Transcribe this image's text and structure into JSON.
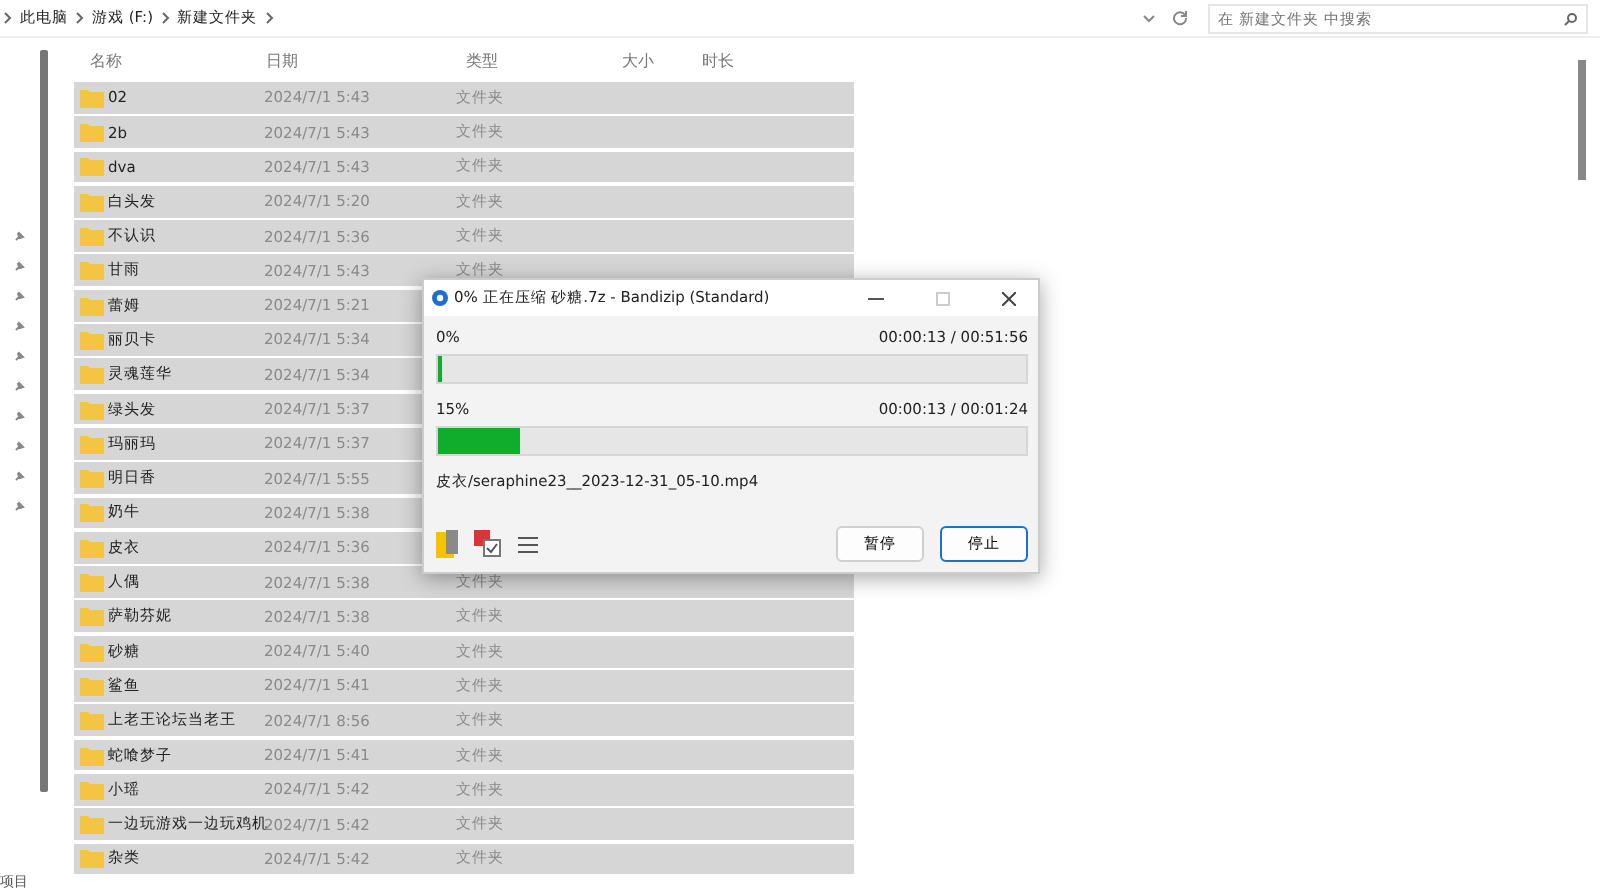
{
  "breadcrumb": [
    "此电脑",
    "游戏 (F:)",
    "新建文件夹"
  ],
  "search": {
    "placeholder": "在 新建文件夹 中搜索"
  },
  "columns": [
    "名称",
    "日期",
    "类型",
    "大小",
    "时长"
  ],
  "rows": [
    {
      "name": "02",
      "date": "2024/7/1 5:43",
      "type": "文件夹"
    },
    {
      "name": "2b",
      "date": "2024/7/1 5:43",
      "type": "文件夹"
    },
    {
      "name": "dva",
      "date": "2024/7/1 5:43",
      "type": "文件夹"
    },
    {
      "name": "白头发",
      "date": "2024/7/1 5:20",
      "type": "文件夹"
    },
    {
      "name": "不认识",
      "date": "2024/7/1 5:36",
      "type": "文件夹"
    },
    {
      "name": "甘雨",
      "date": "2024/7/1 5:43",
      "type": "文件夹"
    },
    {
      "name": "蕾姆",
      "date": "2024/7/1 5:21"
    },
    {
      "name": "丽贝卡",
      "date": "2024/7/1 5:34"
    },
    {
      "name": "灵魂莲华",
      "date": "2024/7/1 5:34"
    },
    {
      "name": "绿头发",
      "date": "2024/7/1 5:37"
    },
    {
      "name": "玛丽玛",
      "date": "2024/7/1 5:37"
    },
    {
      "name": "明日香",
      "date": "2024/7/1 5:55"
    },
    {
      "name": "奶牛",
      "date": "2024/7/1 5:38"
    },
    {
      "name": "皮衣",
      "date": "2024/7/1 5:36"
    },
    {
      "name": "人偶",
      "date": "2024/7/1 5:38",
      "type": "文件夹"
    },
    {
      "name": "萨勒芬妮",
      "date": "2024/7/1 5:38",
      "type": "文件夹"
    },
    {
      "name": "砂糖",
      "date": "2024/7/1 5:40",
      "type": "文件夹"
    },
    {
      "name": "鲨鱼",
      "date": "2024/7/1 5:41",
      "type": "文件夹"
    },
    {
      "name": "上老王论坛当老王",
      "date": "2024/7/1 8:56",
      "type": "文件夹"
    },
    {
      "name": "蛇喰梦子",
      "date": "2024/7/1 5:41",
      "type": "文件夹"
    },
    {
      "name": "小瑶",
      "date": "2024/7/1 5:42",
      "type": "文件夹"
    },
    {
      "name": "一边玩游戏一边玩鸡机",
      "date": "2024/7/1 5:42",
      "type": "文件夹"
    },
    {
      "name": "杂类",
      "date": "2024/7/1 5:42",
      "type": "文件夹"
    }
  ],
  "status_bar": "项目",
  "dialog": {
    "title": "0% 正在压缩 砂糖.7z - Bandizip (Standard)",
    "progress": [
      {
        "percent": "0%",
        "time": "00:00:13 / 00:51:56",
        "level": 0.005
      },
      {
        "percent": "15%",
        "time": "00:00:13 / 00:01:24",
        "level": 0.14
      }
    ],
    "current_file": "皮衣/seraphine23__2023-12-31_05-10.mp4",
    "buttons": [
      {
        "label": "暂停",
        "focused": false
      },
      {
        "label": "停止",
        "focused": true
      }
    ]
  }
}
